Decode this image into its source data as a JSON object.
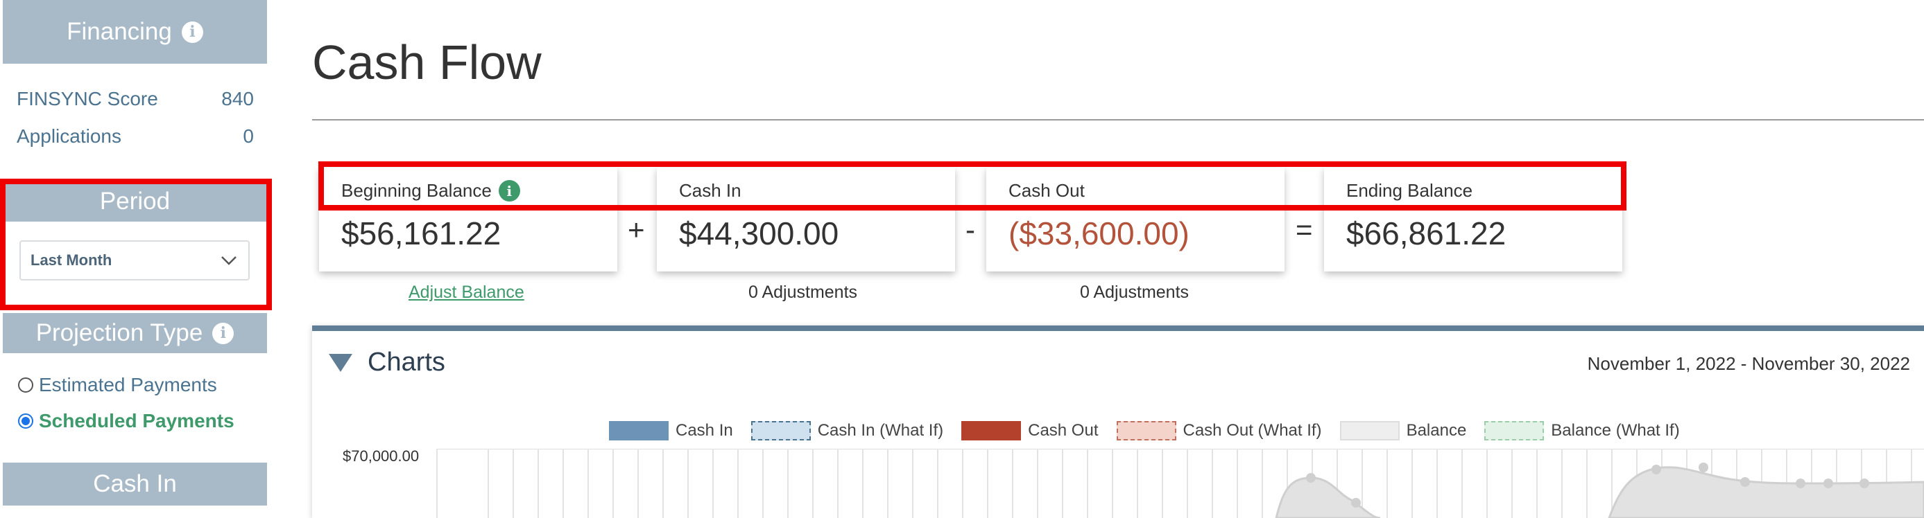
{
  "sidebar": {
    "financing": {
      "title": "Financing",
      "items": [
        {
          "label": "FINSYNC Score",
          "value": "840"
        },
        {
          "label": "Applications",
          "value": "0"
        }
      ]
    },
    "period": {
      "title": "Period",
      "selected": "Last Month"
    },
    "projection_type": {
      "title": "Projection Type",
      "options": [
        {
          "label": "Estimated Payments",
          "checked": false
        },
        {
          "label": "Scheduled Payments",
          "checked": true
        }
      ]
    },
    "cash_in": {
      "title": "Cash In"
    }
  },
  "main": {
    "title": "Cash Flow",
    "cards": [
      {
        "label": "Beginning Balance",
        "value": "$56,161.22",
        "sub": "Adjust Balance"
      },
      {
        "label": "Cash In",
        "value": "$44,300.00",
        "sub": "0 Adjustments"
      },
      {
        "label": "Cash Out",
        "value": "($33,600.00)",
        "sub": "0 Adjustments"
      },
      {
        "label": "Ending Balance",
        "value": "$66,861.22"
      }
    ],
    "operators": [
      "+",
      "-",
      "="
    ],
    "charts": {
      "title": "Charts",
      "date_range": "November 1, 2022 - November 30, 2022",
      "legend": [
        {
          "label": "Cash In",
          "color": "#6d93b6"
        },
        {
          "label": "Cash In (What If)",
          "color": "#cfe0ef"
        },
        {
          "label": "Cash Out",
          "color": "#b3412b"
        },
        {
          "label": "Cash Out (What If)",
          "color": "#f4d3ca"
        },
        {
          "label": "Balance",
          "color": "#eeeeee"
        },
        {
          "label": "Balance (What If)",
          "color": "#e2f2e6"
        }
      ],
      "y_top_label": "$70,000.00"
    }
  },
  "colors": {
    "header_bg": "#a8b9c8",
    "accent_green": "#3e9a6a",
    "negative": "#b4533b",
    "highlight": "#ee0000"
  }
}
